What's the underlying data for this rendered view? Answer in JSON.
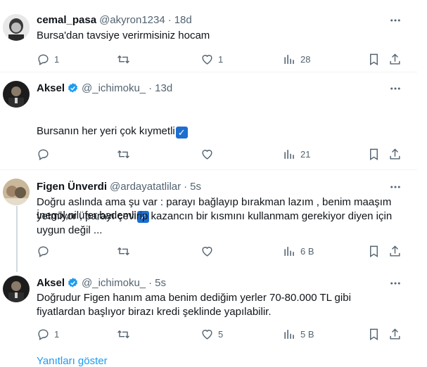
{
  "posts": [
    {
      "name": "cemal_pasa",
      "handle": "@akyron1234",
      "time": "18d",
      "text": "Bursa'dan tavsiye verirmisiniz hocam",
      "replies": "1",
      "retweets": "",
      "likes": "1",
      "views": "28"
    },
    {
      "name": "Aksel",
      "handle": "@_ichimoku_",
      "time": "13d",
      "line1": "Bursanın her yeri çok kıymetli",
      "line2": "İnegöl,nilüfer,bademli",
      "replies": "",
      "retweets": "",
      "likes": "",
      "views": "21"
    },
    {
      "name": "Figen Ünverdi",
      "handle": "@ardayatatlilar",
      "time": "5s",
      "text": "Doğru aslında ama şu var : parayı bağlayıp bırakman lazım , benim maaşım yetmiyor , parayı çevirip kazancın bir kısmını kullanmam gerekiyor diyen için uygun değil ...",
      "replies": "",
      "retweets": "",
      "likes": "",
      "views": "6 B"
    },
    {
      "name": "Aksel",
      "handle": "@_ichimoku_",
      "time": "5s",
      "text": "Doğrudur Figen hanım ama benim dediğim yerler 70-80.000 TL gibi fiyatlardan başlıyor birazı kredi şeklinde yapılabilir.",
      "replies": "1",
      "retweets": "",
      "likes": "5",
      "views": "5 B"
    }
  ],
  "dot": "·",
  "check_emoji": "✓",
  "show_replies": "Yanıtları göster",
  "colors": {
    "accent": "#1d9bf0",
    "muted": "#536471",
    "text": "#0f1419"
  }
}
